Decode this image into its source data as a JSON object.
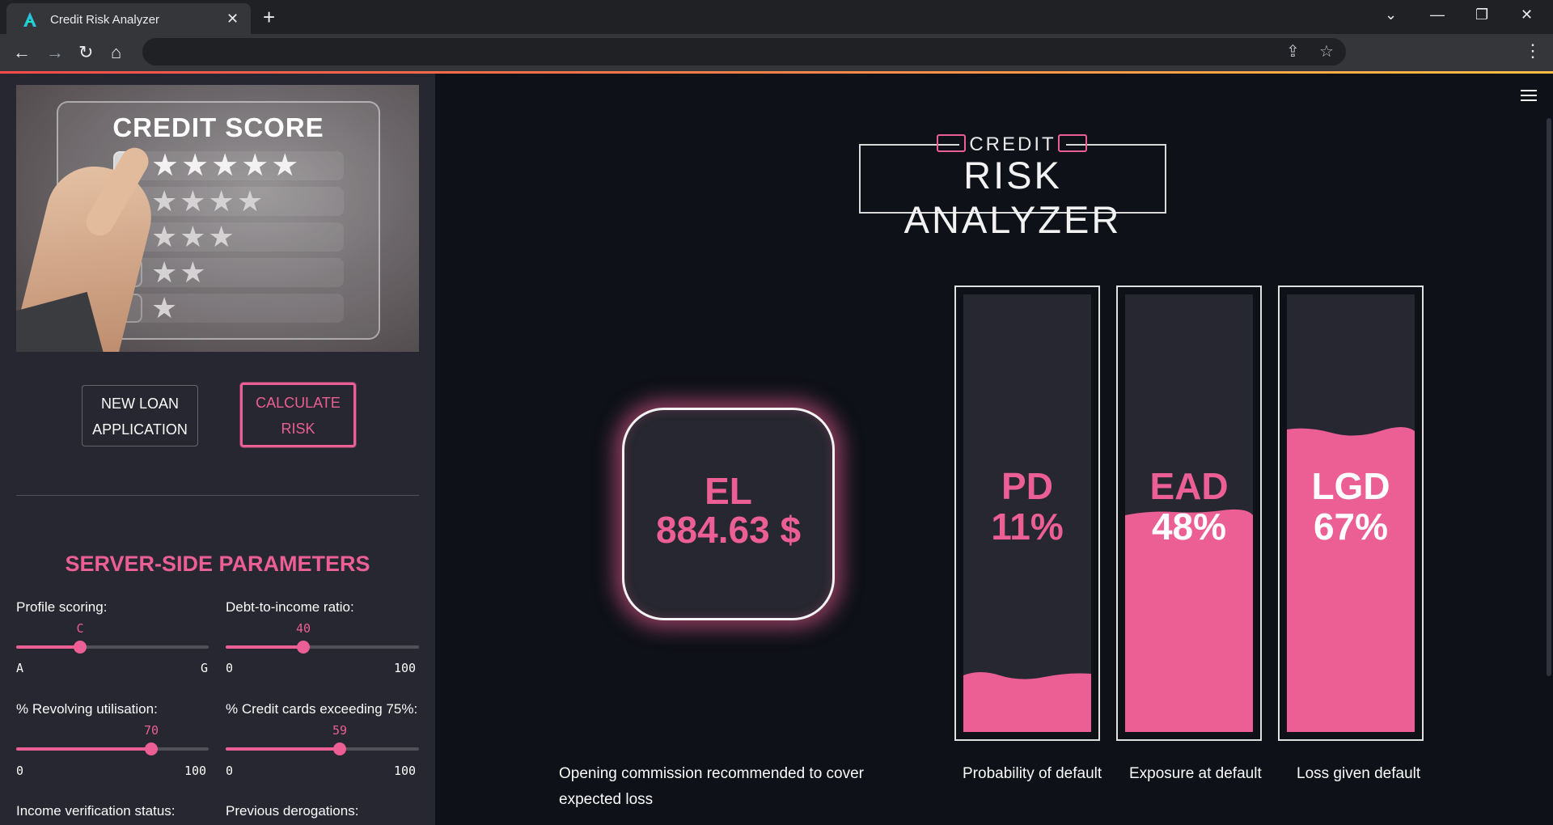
{
  "browser": {
    "tab_title": "Credit Risk Analyzer",
    "tab_close": "✕",
    "new_tab": "+",
    "win_dropdown": "⌄",
    "win_min": "—",
    "win_restore": "❐",
    "win_close": "✕",
    "back": "←",
    "forward": "→",
    "reload": "↻",
    "home": "⌂",
    "share": "⇪",
    "bookmark": "☆",
    "menu": "⋮"
  },
  "sidebar": {
    "hero": {
      "title": "CREDIT SCORE",
      "rows": [
        "★★★★★",
        "★★★★",
        "★★★",
        "★★",
        "★"
      ]
    },
    "buttons": {
      "new_loan": [
        "NEW LOAN",
        "APPLICATION"
      ],
      "calculate": [
        "CALCULATE",
        "RISK"
      ]
    },
    "section_title": "SERVER-SIDE PARAMETERS",
    "sliders": [
      {
        "label": "Profile scoring:",
        "value": "C",
        "min": "A",
        "max": "G",
        "fraction": 0.333
      },
      {
        "label": "Debt-to-income ratio:",
        "value": "40",
        "min": "0",
        "max": "100",
        "fraction": 0.4
      },
      {
        "label": "% Revolving utilisation:",
        "value": "70",
        "min": "0",
        "max": "100",
        "fraction": 0.7
      },
      {
        "label": "% Credit cards exceeding 75%:",
        "value": "59",
        "min": "0",
        "max": "100",
        "fraction": 0.59
      }
    ],
    "bottom_labels": [
      "Income verification status:",
      "Previous derogations:"
    ]
  },
  "main": {
    "logo": {
      "top": "CREDIT",
      "main": "RISK ANALYZER"
    },
    "el": {
      "label": "EL",
      "value": "884.63 $"
    },
    "bars": [
      {
        "label": "PD",
        "value": "11%",
        "fill": 0.11,
        "caption": "Probability of default"
      },
      {
        "label": "EAD",
        "value": "48%",
        "fill": 0.48,
        "caption": "Exposure at default"
      },
      {
        "label": "LGD",
        "value": "67%",
        "fill": 0.67,
        "caption": "Loss given default"
      }
    ],
    "el_caption": [
      "Opening commission recommended to cover",
      "expected loss"
    ]
  },
  "colors": {
    "accent": "#ec5f94",
    "bg": "#0e1117",
    "sidebar": "#262730"
  }
}
